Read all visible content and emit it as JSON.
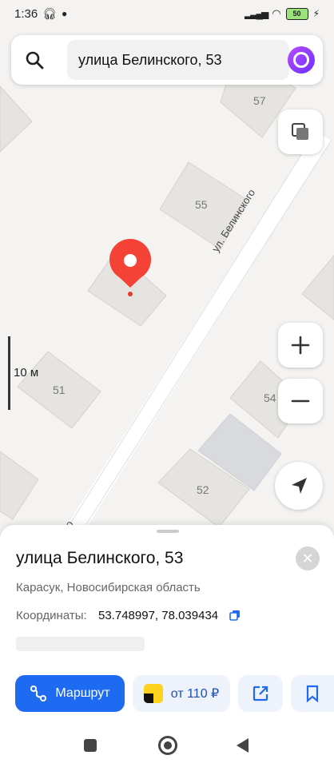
{
  "status_bar": {
    "time": "1:36",
    "battery": "50"
  },
  "search": {
    "query": "улица Белинского, 53"
  },
  "map": {
    "street_label": "ул. Белинского",
    "street_label_cut": "ого",
    "buildings": [
      "57",
      "55",
      "51",
      "54",
      "52"
    ],
    "scale_label": "10 м"
  },
  "place_card": {
    "title": "улица Белинского, 53",
    "subtitle": "Карасук, Новосибирская область",
    "coords_label": "Координаты:",
    "coords_value": "53.748997, 78.039434",
    "route_label": "Маршрут",
    "taxi_label": "от 110 ₽"
  },
  "colors": {
    "accent": "#1e6bf2",
    "pin": "#f44336"
  },
  "icons": {
    "search": "search-icon",
    "alice": "alice-icon",
    "layers": "layers-icon",
    "zoom_in": "plus-icon",
    "zoom_out": "minus-icon",
    "locate": "location-arrow-icon",
    "close": "close-icon",
    "copy": "copy-icon",
    "route": "route-icon",
    "share": "share-icon",
    "bookmark": "bookmark-icon"
  }
}
